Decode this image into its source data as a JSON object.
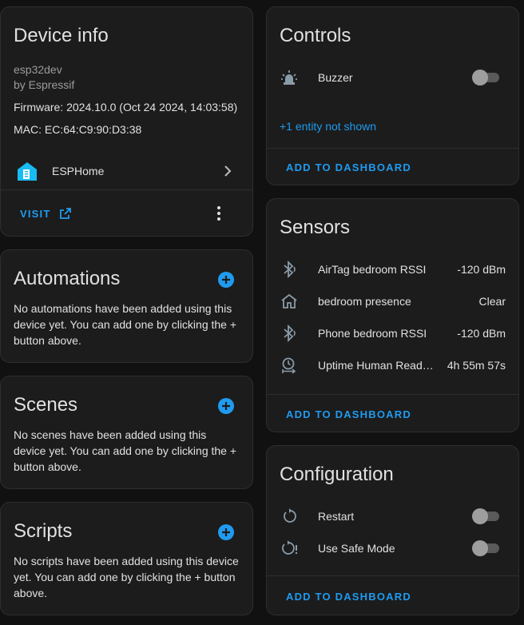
{
  "device_info": {
    "title": "Device info",
    "model": "esp32dev",
    "manufacturer": "by Espressif",
    "firmware": "Firmware: 2024.10.0 (Oct 24 2024, 14:03:58)",
    "mac": "MAC: EC:64:C9:90:D3:38",
    "integration": "ESPHome",
    "visit_label": "VISIT"
  },
  "automations": {
    "title": "Automations",
    "description": "No automations have been added using this device yet. You can add one by clicking the + button above."
  },
  "scenes": {
    "title": "Scenes",
    "description": "No scenes have been added using this device yet. You can add one by clicking the + button above."
  },
  "scripts": {
    "title": "Scripts",
    "description": "No scripts have been added using this device yet. You can add one by clicking the + button above."
  },
  "controls": {
    "title": "Controls",
    "items": [
      {
        "name": "Buzzer",
        "icon": "alarm-light-icon",
        "state": "off"
      }
    ],
    "hidden_text": "+1 entity not shown",
    "add_label": "ADD TO DASHBOARD"
  },
  "sensors": {
    "title": "Sensors",
    "items": [
      {
        "name": "AirTag bedroom RSSI",
        "value": "-120 dBm",
        "icon": "bluetooth-audio-icon"
      },
      {
        "name": "bedroom presence",
        "value": "Clear",
        "icon": "home-outline-icon"
      },
      {
        "name": "Phone bedroom RSSI",
        "value": "-120 dBm",
        "icon": "bluetooth-audio-icon"
      },
      {
        "name": "Uptime Human Readable",
        "value": "4h 55m 57s",
        "icon": "timer-outline-icon"
      }
    ],
    "add_label": "ADD TO DASHBOARD"
  },
  "configuration": {
    "title": "Configuration",
    "items": [
      {
        "name": "Restart",
        "icon": "restart-icon",
        "state": "off"
      },
      {
        "name": "Use Safe Mode",
        "icon": "restart-alert-icon",
        "state": "off"
      }
    ],
    "add_label": "ADD TO DASHBOARD"
  },
  "colors": {
    "background": "#111111",
    "card": "#1c1c1c",
    "accent": "#1f9bf0",
    "icon": "#8a9ba8"
  }
}
